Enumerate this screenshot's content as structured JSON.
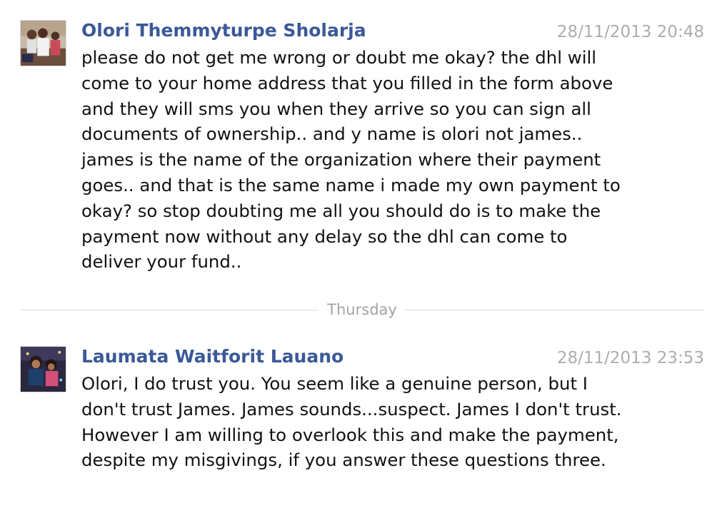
{
  "messages": [
    {
      "sender": "Olori Themmyturpe Sholarja",
      "timestamp": "28/11/2013 20:48",
      "text": "please do not get me wrong or doubt me okay? the dhl will come to your home address that you filled in the form above and they will sms you when they arrive so you can sign all documents of ownership.. and y name is olori not james.. james is the name of the organization where their payment goes.. and that is the same name i made my own payment to okay? so stop doubting me all you should do is to make the payment now without any delay so the dhl can come to deliver your fund..",
      "avatar": "profile-photo-group"
    },
    {
      "sender": "Laumata Waitforit Lauano",
      "timestamp": "28/11/2013 23:53",
      "text": "Olori, I do trust you. You seem like a genuine person, but I don't trust James. James sounds...suspect. James I don't trust. However I am willing to overlook this and make the payment, despite my misgivings, if you answer these questions three.",
      "avatar": "profile-photo-pair"
    }
  ],
  "divider": {
    "label": "Thursday"
  },
  "colors": {
    "sender_name": "#3b5998",
    "timestamp": "#adadad",
    "divider_text": "#a3a3a3",
    "divider_line": "#dcdcdc"
  }
}
